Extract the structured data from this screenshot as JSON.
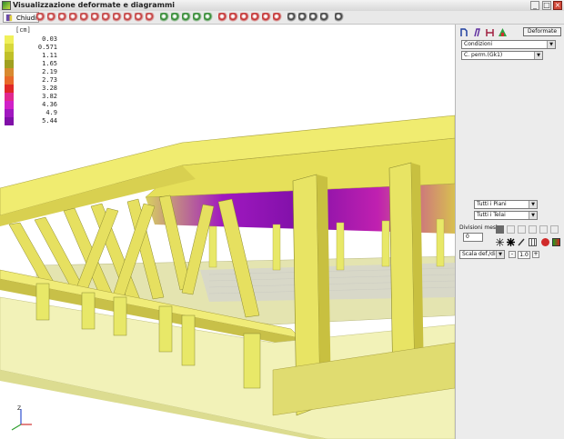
{
  "window": {
    "title": "Visualizzazione deformate e diagrammi"
  },
  "toolbar": {
    "close_label": "Chiudi",
    "icons": [
      "deform-view-icon",
      "deform-view-icon",
      "deform-view-icon",
      "deform-view-icon",
      "deform-view-icon",
      "deform-view-icon",
      "deform-view-icon",
      "deform-view-icon",
      "deform-view-icon",
      "deform-view-icon",
      "deform-view-icon",
      "zoom-icon",
      "zoom-in-icon",
      "zoom-out-icon",
      "zoom-extents-icon",
      "zoom-window-icon",
      "cube-view-icon",
      "cube-view-icon",
      "cube-view-icon",
      "cube-view-icon",
      "cube-view-icon",
      "cube-view-icon",
      "save-icon",
      "save-icon",
      "export-icon",
      "print-icon",
      "settings-icon"
    ]
  },
  "legend": {
    "unit": "[cm]",
    "entries": [
      {
        "value": "0.03",
        "color": "#f0f05a"
      },
      {
        "value": "0.571",
        "color": "#d8d83c"
      },
      {
        "value": "1.11",
        "color": "#c0c028"
      },
      {
        "value": "1.65",
        "color": "#a0a020"
      },
      {
        "value": "2.19",
        "color": "#d88a30"
      },
      {
        "value": "2.73",
        "color": "#e86a2a"
      },
      {
        "value": "3.28",
        "color": "#e02828"
      },
      {
        "value": "3.82",
        "color": "#e02890"
      },
      {
        "value": "4.36",
        "color": "#d020c8"
      },
      {
        "value": "4.9",
        "color": "#a018c0"
      },
      {
        "value": "5.44",
        "color": "#8010a8"
      }
    ]
  },
  "axis": {
    "z_label": "Z"
  },
  "panel": {
    "deformate_label": "Deformate",
    "conditions_select": "Condizioni",
    "load_select": "C. perm.(Gk1)",
    "floors_select": "Tutti i Piani",
    "frames_select": "Tutti i Telai",
    "mesh_label": "Divisioni mesh",
    "mesh_value": "0",
    "scale_select": "Scala def./diag.",
    "scale_value": "1.0",
    "minus_label": "-",
    "plus_label": "+"
  }
}
